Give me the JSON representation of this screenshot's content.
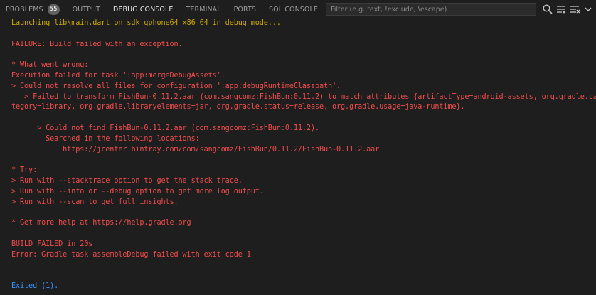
{
  "tabs": [
    {
      "label": "PROBLEMS",
      "badge": "55",
      "active": false
    },
    {
      "label": "OUTPUT",
      "active": false
    },
    {
      "label": "DEBUG CONSOLE",
      "active": true
    },
    {
      "label": "TERMINAL",
      "active": false
    },
    {
      "label": "PORTS",
      "active": false
    },
    {
      "label": "SQL CONSOLE",
      "active": false
    }
  ],
  "filter": {
    "placeholder": "Filter (e.g. text, !exclude, \\escape)",
    "value": ""
  },
  "toolbar_icons": [
    "search-icon",
    "filter-list-icon",
    "clear-console-icon",
    "chevron-icon"
  ],
  "console": {
    "lines": [
      {
        "text": "Launching lib\\main.dart on sdk gphone64 x86 64 in debug mode...",
        "kind": "info"
      },
      {
        "text": "",
        "kind": "err"
      },
      {
        "text": "FAILURE: Build failed with an exception.",
        "kind": "err"
      },
      {
        "text": "",
        "kind": "err"
      },
      {
        "text": "* What went wrong:",
        "kind": "err"
      },
      {
        "text": "Execution failed for task ':app:mergeDebugAssets'.",
        "kind": "err"
      },
      {
        "text": "> Could not resolve all files for configuration ':app:debugRuntimeClasspath'.",
        "kind": "err"
      },
      {
        "text": "   > Failed to transform FishBun-0.11.2.aar (com.sangcomz:FishBun:0.11.2) to match attributes {artifactType=android-assets, org.gradle.category=library, org.gradle.libraryelements=jar, org.gradle.status=release, org.gradle.usage=java-runtime}.",
        "kind": "err"
      },
      {
        "text": "",
        "kind": "err"
      },
      {
        "text": "      > Could not find FishBun-0.11.2.aar (com.sangcomz:FishBun:0.11.2).",
        "kind": "err"
      },
      {
        "text": "        Searched in the following locations:",
        "kind": "err"
      },
      {
        "text": "            https://jcenter.bintray.com/com/sangcomz/FishBun/0.11.2/FishBun-0.11.2.aar",
        "kind": "err"
      },
      {
        "text": "",
        "kind": "err"
      },
      {
        "text": "* Try:",
        "kind": "err"
      },
      {
        "text": "> Run with --stacktrace option to get the stack trace.",
        "kind": "err"
      },
      {
        "text": "> Run with --info or --debug option to get more log output.",
        "kind": "err"
      },
      {
        "text": "> Run with --scan to get full insights.",
        "kind": "err"
      },
      {
        "text": "",
        "kind": "err"
      },
      {
        "text": "* Get more help at https://help.gradle.org",
        "kind": "err"
      },
      {
        "text": "",
        "kind": "err"
      },
      {
        "text": "BUILD FAILED in 20s",
        "kind": "err"
      },
      {
        "text": "Error: Gradle task assembleDebug failed with exit code 1",
        "kind": "err"
      },
      {
        "text": "",
        "kind": "err"
      },
      {
        "text": "",
        "kind": "err"
      },
      {
        "text": "Exited (1).",
        "kind": "blue"
      }
    ]
  },
  "colors": {
    "background": "#1e1e1e",
    "error_text": "#f14c4c",
    "info_text": "#cca700",
    "exit_text": "#3794ff",
    "badge_bg": "#616161",
    "active_tab": "#e7e7e7",
    "inactive_tab": "#9d9d9d"
  }
}
